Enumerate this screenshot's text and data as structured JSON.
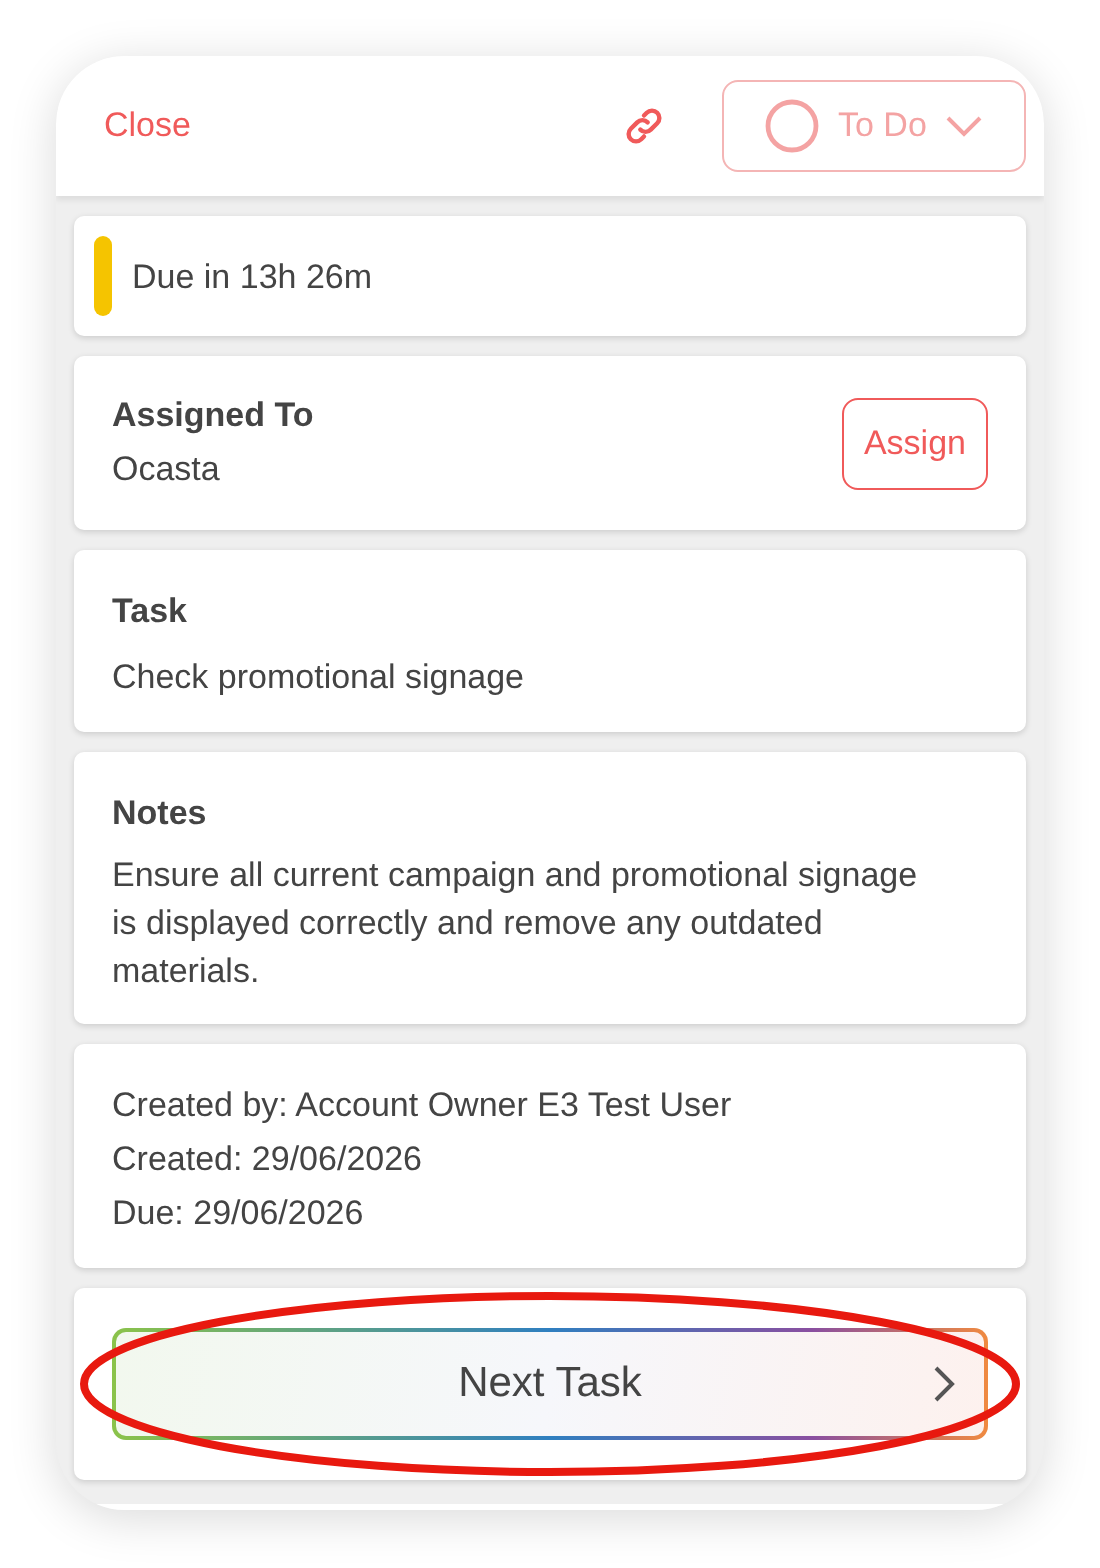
{
  "header": {
    "close": "Close",
    "status": "To Do"
  },
  "due": {
    "text": "Due in 13h 26m",
    "color": "#f5c400"
  },
  "assigned": {
    "label": "Assigned To",
    "value": "Ocasta",
    "button": "Assign"
  },
  "task": {
    "label": "Task",
    "value": "Check promotional signage"
  },
  "notes": {
    "label": "Notes",
    "value": "Ensure all current campaign and promotional signage is displayed correctly and remove any outdated materials."
  },
  "meta": [
    "Created by: Account Owner E3 Test User",
    "Created: 29/06/2026",
    "Due: 29/06/2026"
  ],
  "next_button": {
    "label": "Next Task"
  },
  "highlight": {
    "kind": "ellipse"
  }
}
